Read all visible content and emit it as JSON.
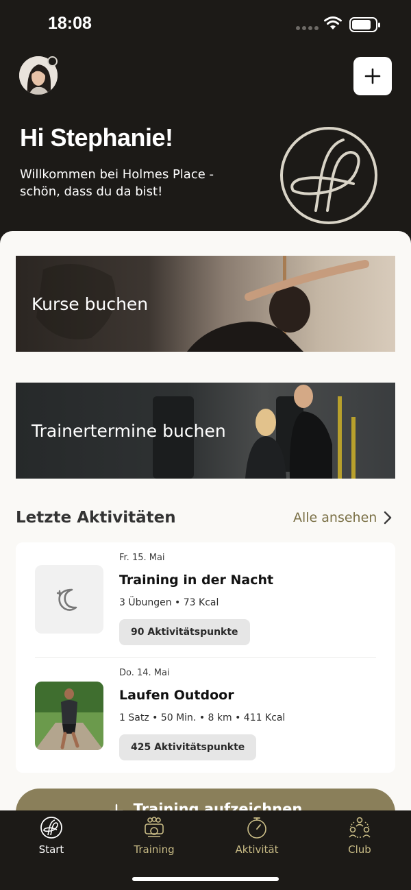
{
  "status_bar": {
    "time": "18:08"
  },
  "header": {
    "greeting": "Hi Stephanie!",
    "welcome": "Willkommen bei Holmes Place - schön, dass du da bist!"
  },
  "banners": [
    {
      "label": "Kurse buchen"
    },
    {
      "label": "Trainertermine buchen"
    }
  ],
  "activities_section": {
    "title": "Letzte Aktivitäten",
    "see_all": "Alle ansehen",
    "items": [
      {
        "date": "Fr. 15. Mai",
        "title": "Training in der Nacht",
        "meta": "3 Übungen • 73 Kcal",
        "points": "90 Aktivitätspunkte",
        "icon": "moon-plus-icon"
      },
      {
        "date": "Do. 14. Mai",
        "title": "Laufen Outdoor",
        "meta": "1 Satz • 50 Min. • 8 km • 411 Kcal",
        "points": "425 Aktivitätspunkte",
        "icon": "runner-photo"
      }
    ]
  },
  "record_button": {
    "label": "Training aufzeichnen"
  },
  "tab_bar": {
    "items": [
      {
        "label": "Start",
        "icon": "brand-logo-icon",
        "active": true
      },
      {
        "label": "Training",
        "icon": "training-group-icon",
        "active": false
      },
      {
        "label": "Aktivität",
        "icon": "stopwatch-icon",
        "active": false
      },
      {
        "label": "Club",
        "icon": "community-icon",
        "active": false
      }
    ]
  },
  "colors": {
    "header_bg": "#1c1a17",
    "accent_gold": "#8a7f5a",
    "link_gold": "#7a7046",
    "sheet_bg": "#faf9f6",
    "tab_active": "#ffffff",
    "tab_inactive": "#c9bc86"
  }
}
